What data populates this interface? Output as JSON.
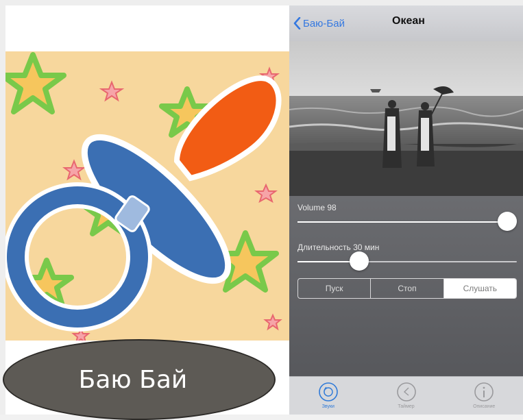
{
  "app_name": "Баю Бай",
  "phone": {
    "nav": {
      "back_label": "Баю-Бай",
      "title": "Океан"
    },
    "volume": {
      "label": "Volume 98",
      "value": 98,
      "max": 100
    },
    "duration": {
      "label": "Длительность 30 мин",
      "fraction": 0.28
    },
    "segments": [
      {
        "label": "Пуск",
        "selected": false
      },
      {
        "label": "Стоп",
        "selected": false
      },
      {
        "label": "Слушать",
        "selected": true
      }
    ],
    "tabs": [
      {
        "icon": "disc-icon",
        "label": "Звуки",
        "active": true
      },
      {
        "icon": "clock-icon",
        "label": "Таймер",
        "active": false
      },
      {
        "icon": "info-icon",
        "label": "Описание",
        "active": false
      }
    ]
  },
  "colors": {
    "accent": "#3478e0",
    "pacifier_blue": "#3b6fb3",
    "pacifier_orange": "#f25c14",
    "star_green": "#7ccb4b",
    "background_peach": "#f7d79d",
    "oval": "#5d5a55"
  }
}
